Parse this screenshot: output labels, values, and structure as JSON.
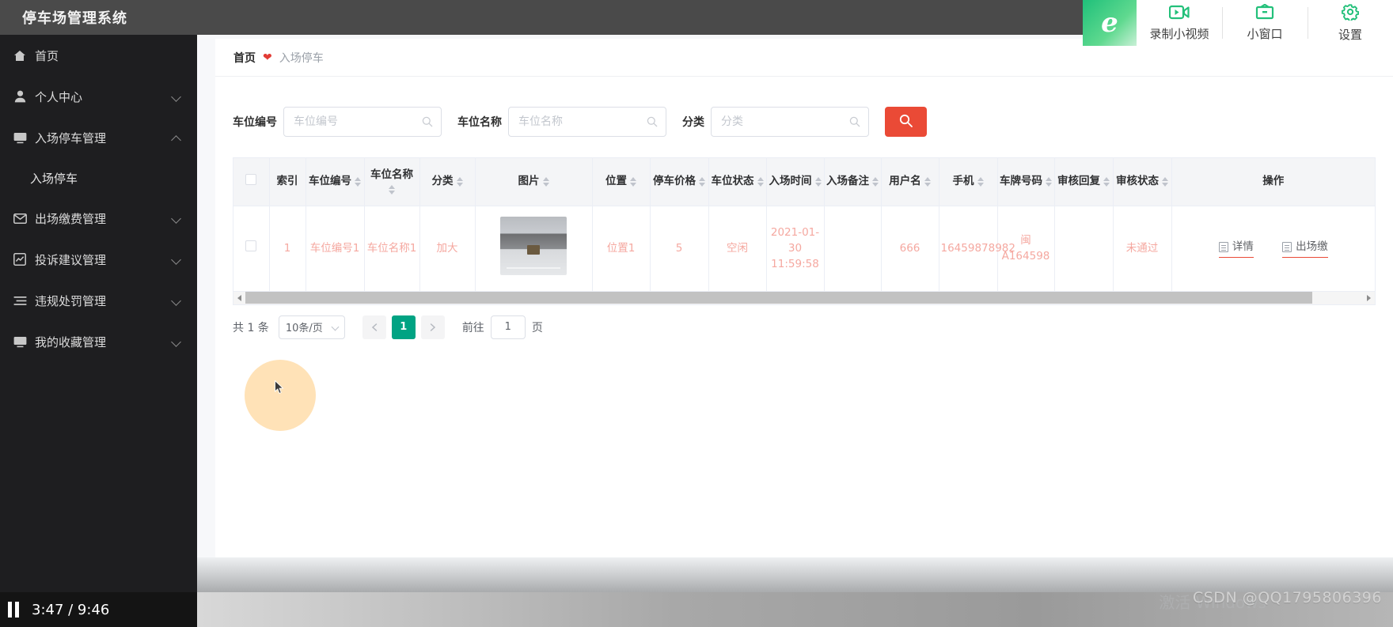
{
  "app": {
    "title": "停车场管理系统"
  },
  "sidebar": {
    "items": [
      {
        "label": "首页",
        "icon": "home-icon",
        "chevron": "none"
      },
      {
        "label": "个人中心",
        "icon": "user-icon",
        "chevron": "down"
      },
      {
        "label": "入场停车管理",
        "icon": "monitor-icon",
        "chevron": "up"
      },
      {
        "label": "出场缴费管理",
        "icon": "mail-icon",
        "chevron": "down"
      },
      {
        "label": "投诉建议管理",
        "icon": "chart-icon",
        "chevron": "down"
      },
      {
        "label": "违规处罚管理",
        "icon": "list-icon",
        "chevron": "down"
      },
      {
        "label": "我的收藏管理",
        "icon": "monitor-icon",
        "chevron": "down"
      }
    ],
    "sub_item": {
      "label": "入场停车"
    }
  },
  "floating_toolbar": {
    "browser_glyph": "e",
    "items": [
      {
        "label": "录制小视频",
        "icon": "video-record-icon"
      },
      {
        "label": "小窗口",
        "icon": "mini-window-icon"
      },
      {
        "label": "设置",
        "icon": "gear-icon"
      }
    ]
  },
  "breadcrumb": {
    "home": "首页",
    "separator_icon": "heart-icon",
    "current": "入场停车"
  },
  "filters": {
    "fields": [
      {
        "label": "车位编号",
        "placeholder": "车位编号",
        "value": ""
      },
      {
        "label": "车位名称",
        "placeholder": "车位名称",
        "value": ""
      },
      {
        "label": "分类",
        "placeholder": "分类",
        "value": ""
      }
    ],
    "search_button_icon": "search-icon",
    "search_button_color": "#ea4a36"
  },
  "table": {
    "columns": [
      {
        "label": "",
        "sortable": false,
        "key": "check"
      },
      {
        "label": "索引",
        "sortable": false,
        "key": "index"
      },
      {
        "label": "车位编号",
        "sortable": true,
        "key": "spot_no"
      },
      {
        "label": "车位名称",
        "sortable": true,
        "key": "spot_name"
      },
      {
        "label": "分类",
        "sortable": true,
        "key": "category"
      },
      {
        "label": "图片",
        "sortable": true,
        "key": "image"
      },
      {
        "label": "位置",
        "sortable": true,
        "key": "position"
      },
      {
        "label": "停车价格",
        "sortable": true,
        "key": "price"
      },
      {
        "label": "车位状态",
        "sortable": true,
        "key": "status"
      },
      {
        "label": "入场时间",
        "sortable": true,
        "key": "enter_time"
      },
      {
        "label": "入场备注",
        "sortable": true,
        "key": "enter_note"
      },
      {
        "label": "用户名",
        "sortable": true,
        "key": "username"
      },
      {
        "label": "手机",
        "sortable": true,
        "key": "phone"
      },
      {
        "label": "车牌号码",
        "sortable": true,
        "key": "plate"
      },
      {
        "label": "审核回复",
        "sortable": true,
        "key": "audit_reply"
      },
      {
        "label": "审核状态",
        "sortable": true,
        "key": "audit_status"
      },
      {
        "label": "操作",
        "sortable": false,
        "key": "ops"
      }
    ],
    "rows": [
      {
        "index": "1",
        "spot_no": "车位编号1",
        "spot_name": "车位名称1",
        "category": "加大",
        "image": "parking-space-photo",
        "position": "位置1",
        "price": "5",
        "status": "空闲",
        "enter_time": "2021-01-30 11:59:58",
        "enter_note": "",
        "username": "666",
        "phone": "16459878982",
        "plate": "闽A164598",
        "audit_reply": "",
        "audit_status": "未通过",
        "ops": [
          {
            "label": "详情",
            "icon": "detail-icon"
          },
          {
            "label": "出场缴",
            "icon": "checkout-icon"
          }
        ]
      }
    ],
    "text_color": "#f5a8a0"
  },
  "pagination": {
    "total_text": "共 1 条",
    "page_size": "10条/页",
    "prev_icon": "chevron-left-icon",
    "next_icon": "chevron-right-icon",
    "pages": [
      "1"
    ],
    "active_page": "1",
    "goto_label": "前往",
    "goto_value": "1",
    "page_unit": "页",
    "active_color": "#00a383"
  },
  "video_player": {
    "state_icon": "pause-icon",
    "time": "3:47 / 9:46"
  },
  "watermarks": {
    "csdn": "CSDN @QQ1795806396",
    "windows": "激活 Windows"
  }
}
